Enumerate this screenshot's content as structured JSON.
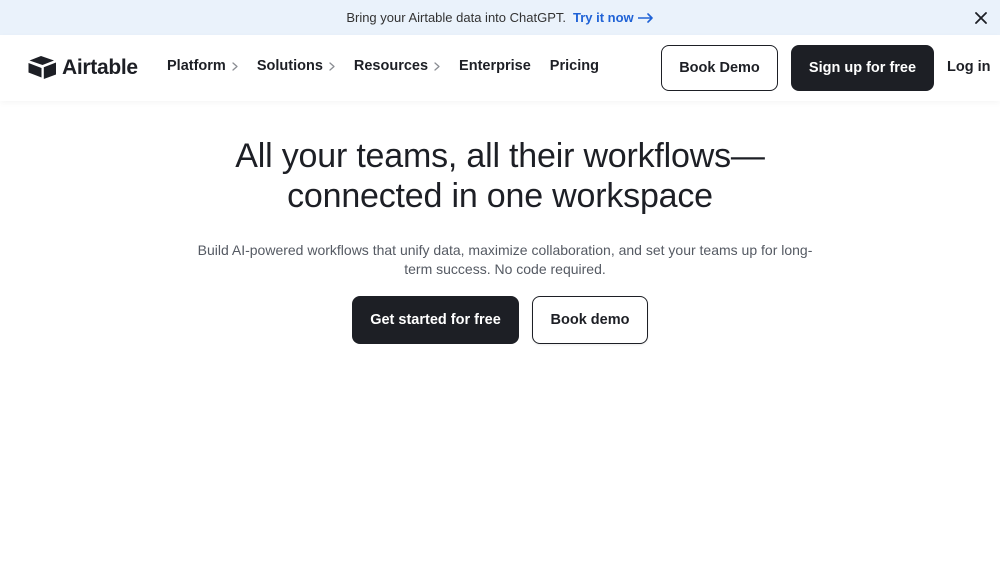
{
  "banner": {
    "text": "Bring your Airtable data into ChatGPT.",
    "link_label": "Try it now",
    "link_icon": "arrow-right-icon",
    "close_icon": "close-icon"
  },
  "header": {
    "logo_text": "Airtable",
    "logo_icon": "airtable-logo-icon",
    "nav": [
      {
        "label": "Platform",
        "has_chevron": true
      },
      {
        "label": "Solutions",
        "has_chevron": true
      },
      {
        "label": "Resources",
        "has_chevron": true
      },
      {
        "label": "Enterprise",
        "has_chevron": false
      },
      {
        "label": "Pricing",
        "has_chevron": false
      }
    ],
    "book_demo_label": "Book Demo",
    "signup_label": "Sign up for free",
    "login_label": "Log in"
  },
  "hero": {
    "title_line1": "All your teams, all their workflows—",
    "title_line2": "connected in one workspace",
    "subtitle": "Build AI-powered workflows that unify data, maximize collaboration, and set your teams up for long-term success. No code required.",
    "primary_cta": "Get started for free",
    "secondary_cta": "Book demo"
  },
  "colors": {
    "banner_bg": "#eaf2fb",
    "link": "#1f62d6",
    "primary": "#1d1f25",
    "text_muted": "#555a63"
  }
}
